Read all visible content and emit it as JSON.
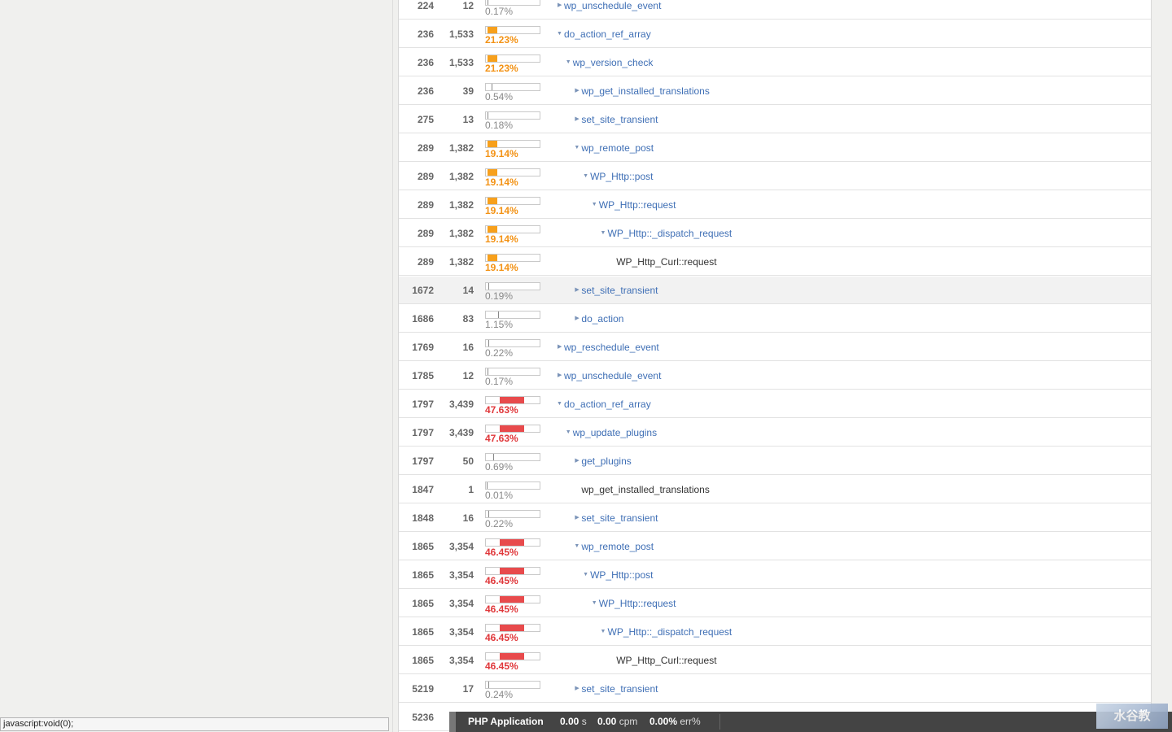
{
  "rows": [
    {
      "start": "224",
      "duration": "12",
      "percent": "0.17%",
      "level": "normal",
      "fill": 0.17,
      "name": "wp_unschedule_event",
      "depth": 0,
      "caret": "right",
      "link": true
    },
    {
      "start": "236",
      "duration": "1,533",
      "percent": "21.23%",
      "level": "orange",
      "fill": 21.23,
      "name": "do_action_ref_array",
      "depth": 0,
      "caret": "down",
      "link": true
    },
    {
      "start": "236",
      "duration": "1,533",
      "percent": "21.23%",
      "level": "orange",
      "fill": 21.23,
      "name": "wp_version_check",
      "depth": 1,
      "caret": "down",
      "link": true
    },
    {
      "start": "236",
      "duration": "39",
      "percent": "0.54%",
      "level": "normal",
      "fill": 0.54,
      "name": "wp_get_installed_translations",
      "depth": 2,
      "caret": "right",
      "link": true
    },
    {
      "start": "275",
      "duration": "13",
      "percent": "0.18%",
      "level": "normal",
      "fill": 0.18,
      "name": "set_site_transient",
      "depth": 2,
      "caret": "right",
      "link": true
    },
    {
      "start": "289",
      "duration": "1,382",
      "percent": "19.14%",
      "level": "orange",
      "fill": 19.14,
      "name": "wp_remote_post",
      "depth": 2,
      "caret": "down",
      "link": true
    },
    {
      "start": "289",
      "duration": "1,382",
      "percent": "19.14%",
      "level": "orange",
      "fill": 19.14,
      "name": "WP_Http::post",
      "depth": 3,
      "caret": "down",
      "link": true
    },
    {
      "start": "289",
      "duration": "1,382",
      "percent": "19.14%",
      "level": "orange",
      "fill": 19.14,
      "name": "WP_Http::request",
      "depth": 4,
      "caret": "down",
      "link": true
    },
    {
      "start": "289",
      "duration": "1,382",
      "percent": "19.14%",
      "level": "orange",
      "fill": 19.14,
      "name": "WP_Http::_dispatch_request",
      "depth": 5,
      "caret": "down",
      "link": true
    },
    {
      "start": "289",
      "duration": "1,382",
      "percent": "19.14%",
      "level": "orange",
      "fill": 19.14,
      "name": "WP_Http_Curl::request",
      "depth": 6,
      "caret": "none",
      "link": false
    },
    {
      "start": "1672",
      "duration": "14",
      "percent": "0.19%",
      "level": "normal",
      "fill": 0.19,
      "name": "set_site_transient",
      "depth": 2,
      "caret": "right",
      "link": true,
      "highlight": true
    },
    {
      "start": "1686",
      "duration": "83",
      "percent": "1.15%",
      "level": "normal",
      "fill": 1.15,
      "name": "do_action",
      "depth": 2,
      "caret": "right",
      "link": true
    },
    {
      "start": "1769",
      "duration": "16",
      "percent": "0.22%",
      "level": "normal",
      "fill": 0.22,
      "name": "wp_reschedule_event",
      "depth": 0,
      "caret": "right",
      "link": true
    },
    {
      "start": "1785",
      "duration": "12",
      "percent": "0.17%",
      "level": "normal",
      "fill": 0.17,
      "name": "wp_unschedule_event",
      "depth": 0,
      "caret": "right",
      "link": true
    },
    {
      "start": "1797",
      "duration": "3,439",
      "percent": "47.63%",
      "level": "red",
      "fill": 47.63,
      "name": "do_action_ref_array",
      "depth": 0,
      "caret": "down",
      "link": true
    },
    {
      "start": "1797",
      "duration": "3,439",
      "percent": "47.63%",
      "level": "red",
      "fill": 47.63,
      "name": "wp_update_plugins",
      "depth": 1,
      "caret": "down",
      "link": true
    },
    {
      "start": "1797",
      "duration": "50",
      "percent": "0.69%",
      "level": "normal",
      "fill": 0.69,
      "name": "get_plugins",
      "depth": 2,
      "caret": "right",
      "link": true
    },
    {
      "start": "1847",
      "duration": "1",
      "percent": "0.01%",
      "level": "normal",
      "fill": 0.01,
      "name": "wp_get_installed_translations",
      "depth": 2,
      "caret": "none",
      "link": false
    },
    {
      "start": "1848",
      "duration": "16",
      "percent": "0.22%",
      "level": "normal",
      "fill": 0.22,
      "name": "set_site_transient",
      "depth": 2,
      "caret": "right",
      "link": true
    },
    {
      "start": "1865",
      "duration": "3,354",
      "percent": "46.45%",
      "level": "red",
      "fill": 46.45,
      "name": "wp_remote_post",
      "depth": 2,
      "caret": "down",
      "link": true
    },
    {
      "start": "1865",
      "duration": "3,354",
      "percent": "46.45%",
      "level": "red",
      "fill": 46.45,
      "name": "WP_Http::post",
      "depth": 3,
      "caret": "down",
      "link": true
    },
    {
      "start": "1865",
      "duration": "3,354",
      "percent": "46.45%",
      "level": "red",
      "fill": 46.45,
      "name": "WP_Http::request",
      "depth": 4,
      "caret": "down",
      "link": true
    },
    {
      "start": "1865",
      "duration": "3,354",
      "percent": "46.45%",
      "level": "red",
      "fill": 46.45,
      "name": "WP_Http::_dispatch_request",
      "depth": 5,
      "caret": "down",
      "link": true
    },
    {
      "start": "1865",
      "duration": "3,354",
      "percent": "46.45%",
      "level": "red",
      "fill": 46.45,
      "name": "WP_Http_Curl::request",
      "depth": 6,
      "caret": "none",
      "link": false
    },
    {
      "start": "5219",
      "duration": "17",
      "percent": "0.24%",
      "level": "normal",
      "fill": 0.24,
      "name": "set_site_transient",
      "depth": 2,
      "caret": "right",
      "link": true
    },
    {
      "start": "5236",
      "duration": "",
      "percent": "",
      "level": "normal",
      "fill": 0,
      "name": "",
      "depth": 0,
      "caret": "none",
      "link": false
    }
  ],
  "colors": {
    "orange": "#f7a01c",
    "red": "#e84a4c",
    "link": "#3f6fb5"
  },
  "status_bar": {
    "url": "javascript:void(0);"
  },
  "footer": {
    "app_name": "PHP Application",
    "response_time": "0.00",
    "response_unit": "s",
    "throughput": "0.00",
    "throughput_unit": "cpm",
    "error_rate": "0.00%",
    "error_unit": "err%"
  },
  "watermark": {
    "text": "水谷教"
  }
}
